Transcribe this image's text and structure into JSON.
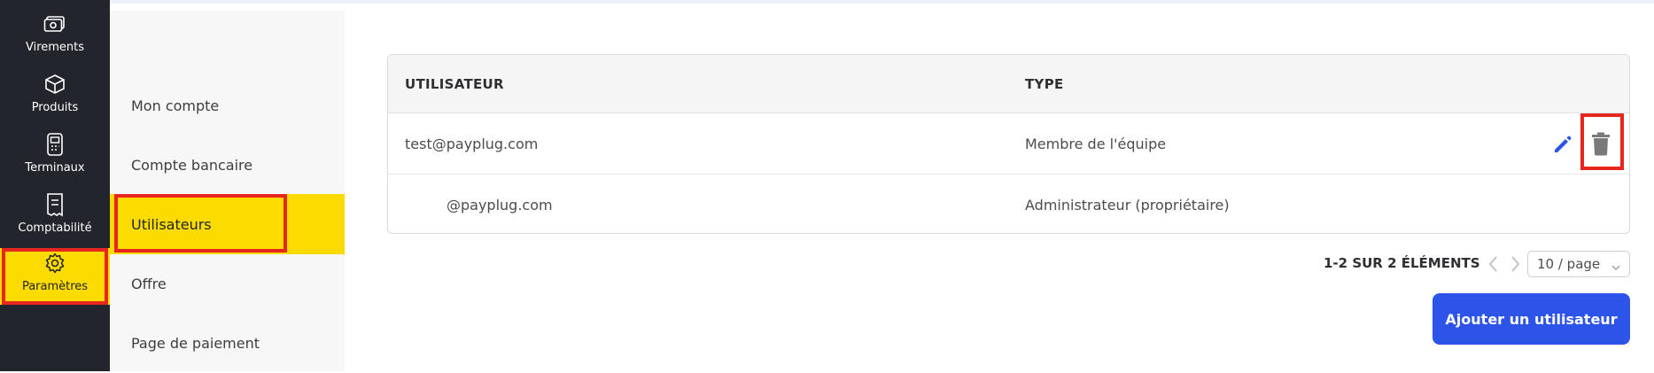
{
  "nav": {
    "items": [
      {
        "label": "Virements",
        "icon": "money-transfer-icon"
      },
      {
        "label": "Produits",
        "icon": "box-icon"
      },
      {
        "label": "Terminaux",
        "icon": "terminal-icon"
      },
      {
        "label": "Comptabilité",
        "icon": "receipt-icon"
      },
      {
        "label": "Paramètres",
        "icon": "gear-icon"
      }
    ]
  },
  "settings_menu": {
    "items": [
      "Mon compte",
      "Compte bancaire",
      "Utilisateurs",
      "Offre",
      "Page de paiement"
    ]
  },
  "table": {
    "headers": {
      "user": "UTILISATEUR",
      "type": "TYPE"
    },
    "rows": [
      {
        "user": "test@payplug.com",
        "type": "Membre de l'équipe"
      },
      {
        "user": "@payplug.com",
        "type": "Administrateur (propriétaire)"
      }
    ]
  },
  "pagination": {
    "summary": "1-2 SUR 2 ÉLÉMENTS",
    "page_size": "10 / page"
  },
  "actions": {
    "add_user": "Ajouter un utilisateur"
  },
  "colors": {
    "nav_bg": "#22252b",
    "active_yellow": "#fcdc00",
    "primary": "#2c54e8",
    "highlight_red": "#e6261f"
  }
}
